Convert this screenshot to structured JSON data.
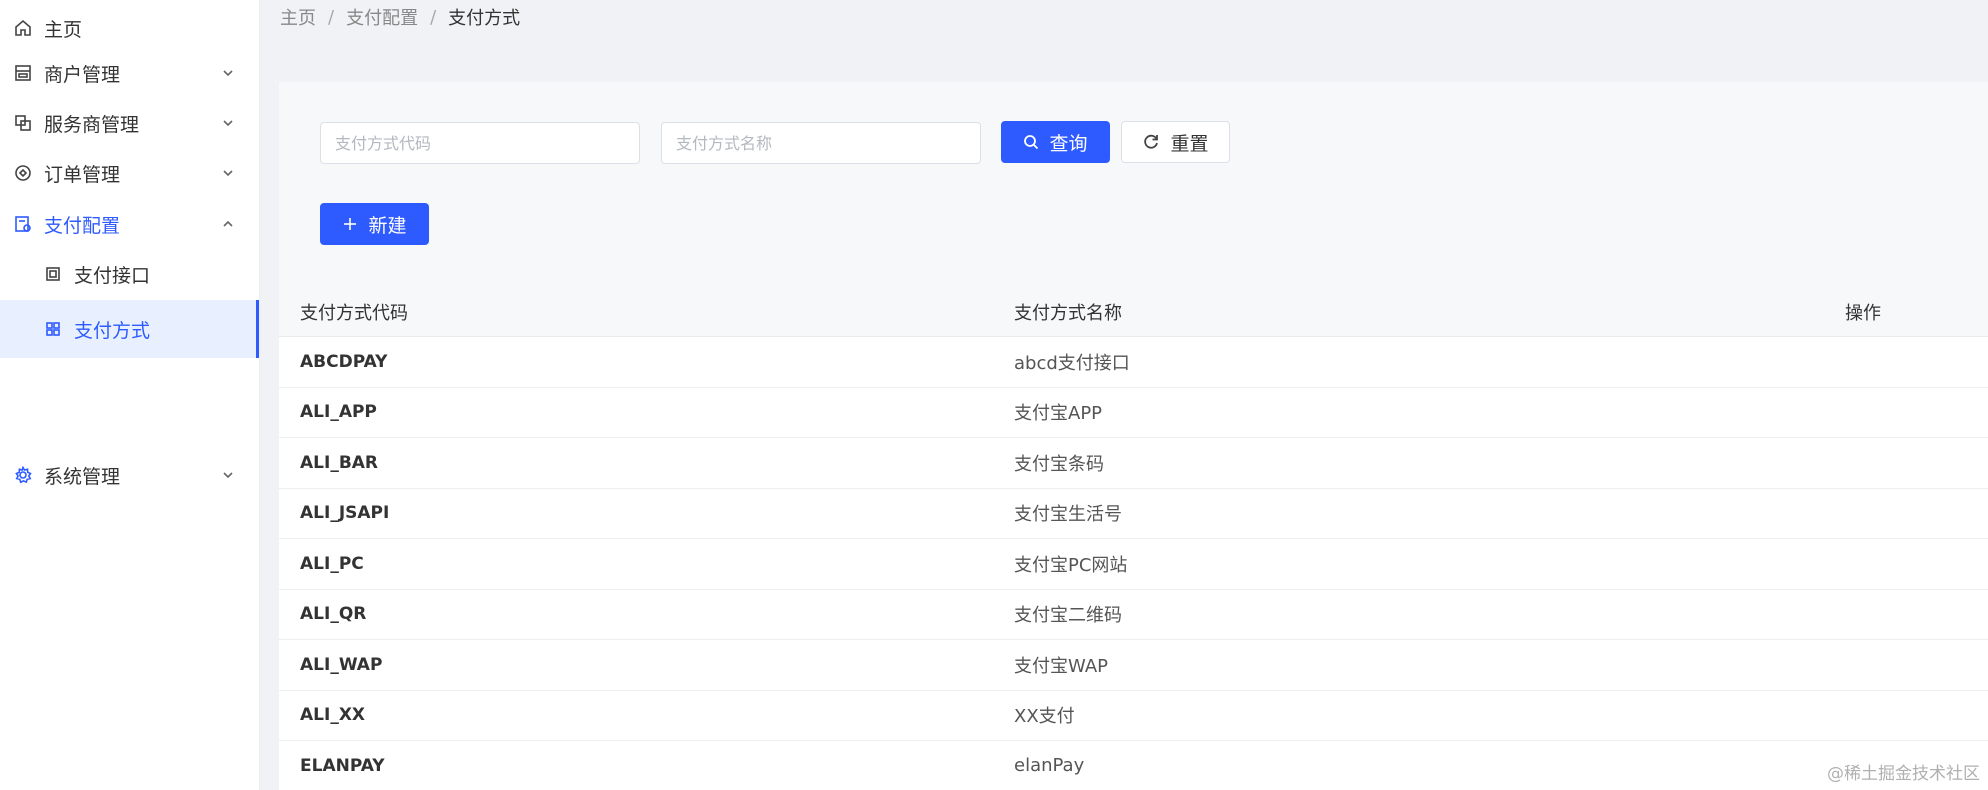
{
  "sidebar": {
    "items": [
      {
        "label": "主页",
        "icon": "home-icon"
      },
      {
        "label": "商户管理",
        "icon": "store-icon"
      },
      {
        "label": "服务商管理",
        "icon": "copy-icon"
      },
      {
        "label": "订单管理",
        "icon": "order-icon"
      },
      {
        "label": "支付配置",
        "icon": "config-icon"
      },
      {
        "label": "支付接口",
        "icon": "square-icon"
      },
      {
        "label": "支付方式",
        "icon": "grid-icon"
      },
      {
        "label": "系统管理",
        "icon": "gear-icon"
      }
    ]
  },
  "breadcrumb": {
    "home": "主页",
    "parent": "支付配置",
    "current": "支付方式",
    "separator": "/"
  },
  "search": {
    "code_placeholder": "支付方式代码",
    "name_placeholder": "支付方式名称",
    "query_label": "查询",
    "reset_label": "重置"
  },
  "toolbar": {
    "new_label": "新建"
  },
  "table": {
    "columns": [
      "支付方式代码",
      "支付方式名称",
      "操作"
    ],
    "rows": [
      {
        "code": "ABCDPAY",
        "name": "abcd支付接口"
      },
      {
        "code": "ALI_APP",
        "name": "支付宝APP"
      },
      {
        "code": "ALI_BAR",
        "name": "支付宝条码"
      },
      {
        "code": "ALI_JSAPI",
        "name": "支付宝生活号"
      },
      {
        "code": "ALI_PC",
        "name": "支付宝PC网站"
      },
      {
        "code": "ALI_QR",
        "name": "支付宝二维码"
      },
      {
        "code": "ALI_WAP",
        "name": "支付宝WAP"
      },
      {
        "code": "ALI_XX",
        "name": "XX支付"
      },
      {
        "code": "ELANPAY",
        "name": "elanPay"
      }
    ]
  },
  "watermark": "@稀土掘金技术社区",
  "colors": {
    "accent": "#2e5bff",
    "active_bg": "#e8f0ff"
  }
}
